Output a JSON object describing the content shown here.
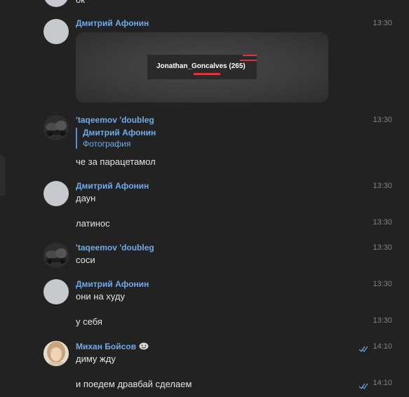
{
  "chat": {
    "messages": [
      {
        "text": "ок"
      },
      {
        "author": "Дмитрий Афонин",
        "time": "13:30",
        "attachment": {
          "type": "photo",
          "caption_text": "Jonathan_Goncalves (265)"
        }
      },
      {
        "author": "'taqeemov 'doubleg",
        "time": "13:30",
        "reply": {
          "author": "Дмитрий Афонин",
          "text": "Фотография"
        },
        "text": "че за парацетамол"
      },
      {
        "author": "Дмитрий Афонин",
        "time": "13:30",
        "text": "даун"
      },
      {
        "time": "13:30",
        "text": "латинос"
      },
      {
        "author": "'taqeemov 'doubleg",
        "time": "13:30",
        "text": "соси"
      },
      {
        "author": "Дмитрий Афонин",
        "time": "13:30",
        "text": "они на худу"
      },
      {
        "time": "13:30",
        "text": "у себя"
      },
      {
        "author": "Михан Бойсов",
        "author_emoji": "smiling-face-emoji",
        "time": "14:10",
        "text": "диму жду",
        "status": "read"
      },
      {
        "time": "14:10",
        "text": "и поедем дравбай сделаем",
        "status": "read"
      }
    ]
  },
  "colors": {
    "background": "#222222",
    "author_name": "#71aaeb",
    "message_text": "#e1e3e6",
    "timestamp": "#828282",
    "read_check": "#71aaeb"
  }
}
